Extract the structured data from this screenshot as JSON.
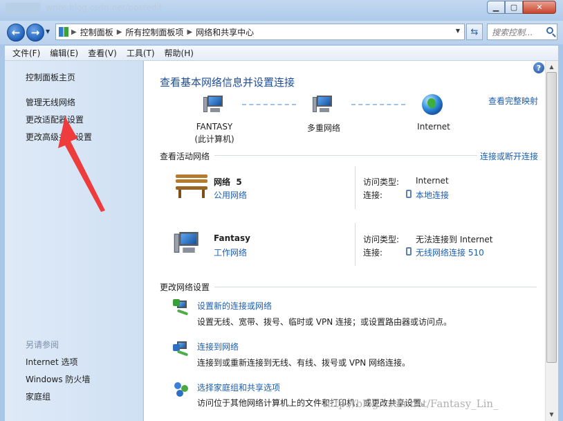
{
  "window": {
    "title": "write.blog.csdn.net/postedit"
  },
  "nav": {
    "breadcrumb": [
      "控制面板",
      "所有控制面板项",
      "网络和共享中心"
    ],
    "search_placeholder": "搜索控制..."
  },
  "menu": [
    "文件(F)",
    "编辑(E)",
    "查看(V)",
    "工具(T)",
    "帮助(H)"
  ],
  "sidebar": {
    "home": "控制面板主页",
    "links": [
      "管理无线网络",
      "更改适配器设置",
      "更改高级共享设置"
    ],
    "see_also_heading": "另请参阅",
    "see_also": [
      "Internet 选项",
      "Windows 防火墙",
      "家庭组"
    ]
  },
  "main": {
    "title": "查看基本网络信息并设置连接",
    "full_map_link": "查看完整映射",
    "map": {
      "computer_name": "FANTASY",
      "computer_sub": "(此计算机)",
      "middle": "多重网络",
      "internet": "Internet"
    },
    "active_heading": "查看活动网络",
    "connect_link": "连接或断开连接",
    "networks": [
      {
        "name": "网络  5",
        "type_link": "公用网络",
        "access_label": "访问类型:",
        "access_value": "Internet",
        "conn_label": "连接:",
        "conn_value": "本地连接"
      },
      {
        "name": "Fantasy",
        "type_link": "工作网络",
        "access_label": "访问类型:",
        "access_value": "无法连接到 Internet",
        "conn_label": "连接:",
        "conn_value": "无线网络连接 510"
      }
    ],
    "change_heading": "更改网络设置",
    "tasks": [
      {
        "title": "设置新的连接或网络",
        "desc": "设置无线、宽带、拨号、临时或 VPN 连接；或设置路由器或访问点。"
      },
      {
        "title": "连接到网络",
        "desc": "连接到或重新连接到无线、有线、拨号或 VPN 网络连接。"
      },
      {
        "title": "选择家庭组和共享选项",
        "desc": "访问位于其他网络计算机上的文件和打印机，或更改共享设置。"
      }
    ]
  },
  "watermark": "http://blog.csdn.net/Fantasy_Lin_",
  "colors": {
    "link": "#1a5fb4",
    "title": "#1e4d9b",
    "annotation_arrow": "#ee3b3b"
  }
}
